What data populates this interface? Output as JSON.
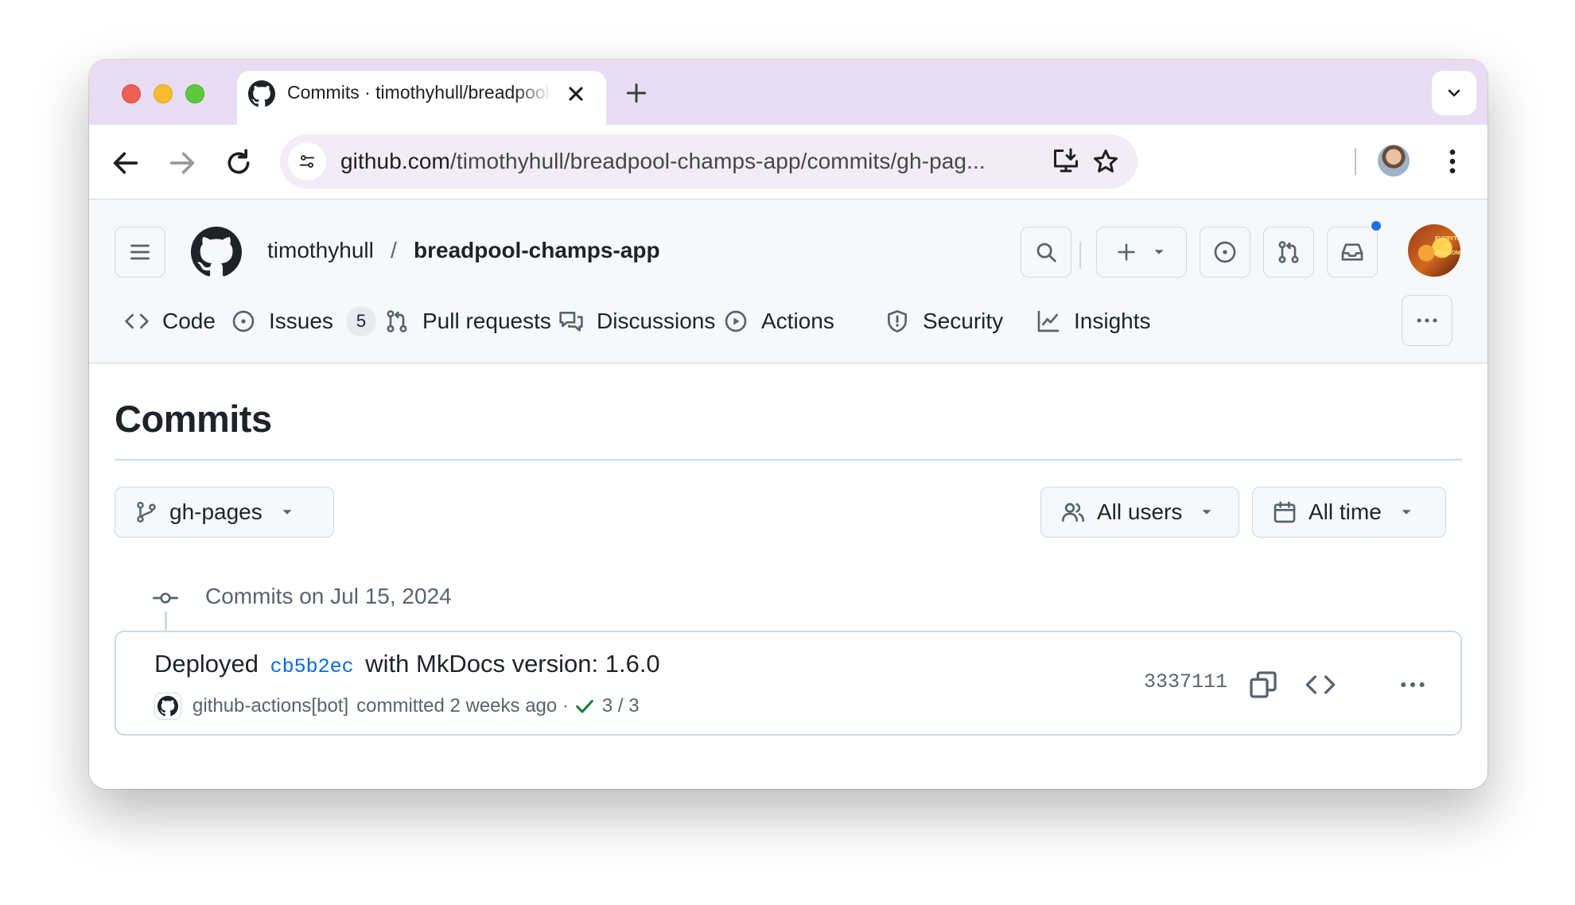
{
  "browser": {
    "tab_title": "Commits · timothyhull/breadpool-champs-app",
    "url_host": "github.com",
    "url_path": "/timothyhull/breadpool-champs-app/commits/gh-pag..."
  },
  "header": {
    "owner": "timothyhull",
    "separator": "/",
    "repo": "breadpool-champs-app",
    "avatar_text": "Everything is AWESOME!"
  },
  "repo_nav": [
    {
      "label": "Code",
      "icon": "code-icon"
    },
    {
      "label": "Issues",
      "icon": "issue-icon",
      "count": "5"
    },
    {
      "label": "Pull requests",
      "icon": "pull-request-icon"
    },
    {
      "label": "Discussions",
      "icon": "discussions-icon"
    },
    {
      "label": "Actions",
      "icon": "play-icon"
    },
    {
      "label": "Security",
      "icon": "shield-icon"
    },
    {
      "label": "Insights",
      "icon": "graph-icon"
    }
  ],
  "page": {
    "title": "Commits",
    "branch": "gh-pages",
    "users_filter": "All users",
    "time_filter": "All time",
    "group_heading": "Commits on Jul 15, 2024"
  },
  "commit": {
    "message_prefix": "Deployed",
    "message_sha": "cb5b2ec",
    "message_suffix": "with MkDocs version: 1.6.0",
    "author": "github-actions[bot]",
    "committed": "committed 2 weeks ago ·",
    "checks": "3 / 3",
    "short_sha": "3337111"
  },
  "colors": {
    "tab_strip": "#e8ddf3",
    "link": "#0969da",
    "success": "#1a7f37",
    "notification": "#1f6feb"
  }
}
